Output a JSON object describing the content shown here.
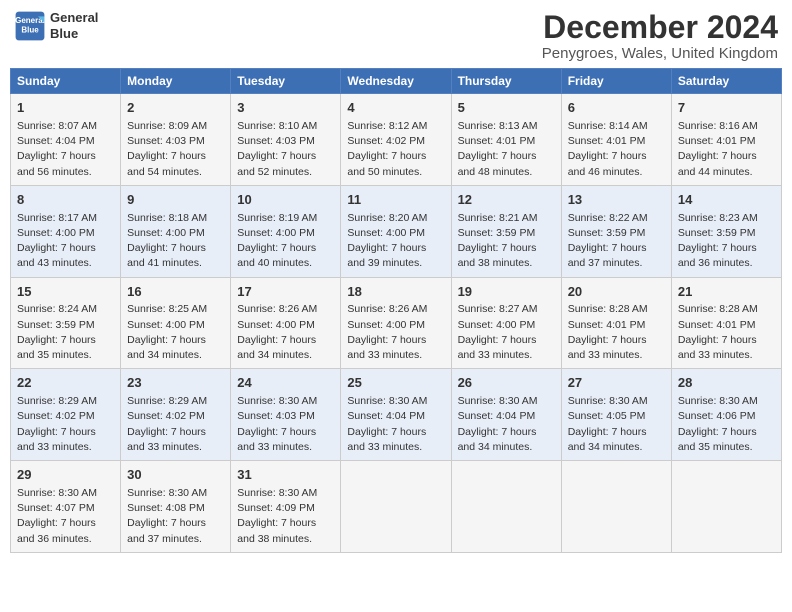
{
  "header": {
    "logo_line1": "General",
    "logo_line2": "Blue",
    "title": "December 2024",
    "subtitle": "Penygroes, Wales, United Kingdom"
  },
  "days_of_week": [
    "Sunday",
    "Monday",
    "Tuesday",
    "Wednesday",
    "Thursday",
    "Friday",
    "Saturday"
  ],
  "weeks": [
    [
      {
        "day": "1",
        "info": "Sunrise: 8:07 AM\nSunset: 4:04 PM\nDaylight: 7 hours\nand 56 minutes."
      },
      {
        "day": "2",
        "info": "Sunrise: 8:09 AM\nSunset: 4:03 PM\nDaylight: 7 hours\nand 54 minutes."
      },
      {
        "day": "3",
        "info": "Sunrise: 8:10 AM\nSunset: 4:03 PM\nDaylight: 7 hours\nand 52 minutes."
      },
      {
        "day": "4",
        "info": "Sunrise: 8:12 AM\nSunset: 4:02 PM\nDaylight: 7 hours\nand 50 minutes."
      },
      {
        "day": "5",
        "info": "Sunrise: 8:13 AM\nSunset: 4:01 PM\nDaylight: 7 hours\nand 48 minutes."
      },
      {
        "day": "6",
        "info": "Sunrise: 8:14 AM\nSunset: 4:01 PM\nDaylight: 7 hours\nand 46 minutes."
      },
      {
        "day": "7",
        "info": "Sunrise: 8:16 AM\nSunset: 4:01 PM\nDaylight: 7 hours\nand 44 minutes."
      }
    ],
    [
      {
        "day": "8",
        "info": "Sunrise: 8:17 AM\nSunset: 4:00 PM\nDaylight: 7 hours\nand 43 minutes."
      },
      {
        "day": "9",
        "info": "Sunrise: 8:18 AM\nSunset: 4:00 PM\nDaylight: 7 hours\nand 41 minutes."
      },
      {
        "day": "10",
        "info": "Sunrise: 8:19 AM\nSunset: 4:00 PM\nDaylight: 7 hours\nand 40 minutes."
      },
      {
        "day": "11",
        "info": "Sunrise: 8:20 AM\nSunset: 4:00 PM\nDaylight: 7 hours\nand 39 minutes."
      },
      {
        "day": "12",
        "info": "Sunrise: 8:21 AM\nSunset: 3:59 PM\nDaylight: 7 hours\nand 38 minutes."
      },
      {
        "day": "13",
        "info": "Sunrise: 8:22 AM\nSunset: 3:59 PM\nDaylight: 7 hours\nand 37 minutes."
      },
      {
        "day": "14",
        "info": "Sunrise: 8:23 AM\nSunset: 3:59 PM\nDaylight: 7 hours\nand 36 minutes."
      }
    ],
    [
      {
        "day": "15",
        "info": "Sunrise: 8:24 AM\nSunset: 3:59 PM\nDaylight: 7 hours\nand 35 minutes."
      },
      {
        "day": "16",
        "info": "Sunrise: 8:25 AM\nSunset: 4:00 PM\nDaylight: 7 hours\nand 34 minutes."
      },
      {
        "day": "17",
        "info": "Sunrise: 8:26 AM\nSunset: 4:00 PM\nDaylight: 7 hours\nand 34 minutes."
      },
      {
        "day": "18",
        "info": "Sunrise: 8:26 AM\nSunset: 4:00 PM\nDaylight: 7 hours\nand 33 minutes."
      },
      {
        "day": "19",
        "info": "Sunrise: 8:27 AM\nSunset: 4:00 PM\nDaylight: 7 hours\nand 33 minutes."
      },
      {
        "day": "20",
        "info": "Sunrise: 8:28 AM\nSunset: 4:01 PM\nDaylight: 7 hours\nand 33 minutes."
      },
      {
        "day": "21",
        "info": "Sunrise: 8:28 AM\nSunset: 4:01 PM\nDaylight: 7 hours\nand 33 minutes."
      }
    ],
    [
      {
        "day": "22",
        "info": "Sunrise: 8:29 AM\nSunset: 4:02 PM\nDaylight: 7 hours\nand 33 minutes."
      },
      {
        "day": "23",
        "info": "Sunrise: 8:29 AM\nSunset: 4:02 PM\nDaylight: 7 hours\nand 33 minutes."
      },
      {
        "day": "24",
        "info": "Sunrise: 8:30 AM\nSunset: 4:03 PM\nDaylight: 7 hours\nand 33 minutes."
      },
      {
        "day": "25",
        "info": "Sunrise: 8:30 AM\nSunset: 4:04 PM\nDaylight: 7 hours\nand 33 minutes."
      },
      {
        "day": "26",
        "info": "Sunrise: 8:30 AM\nSunset: 4:04 PM\nDaylight: 7 hours\nand 34 minutes."
      },
      {
        "day": "27",
        "info": "Sunrise: 8:30 AM\nSunset: 4:05 PM\nDaylight: 7 hours\nand 34 minutes."
      },
      {
        "day": "28",
        "info": "Sunrise: 8:30 AM\nSunset: 4:06 PM\nDaylight: 7 hours\nand 35 minutes."
      }
    ],
    [
      {
        "day": "29",
        "info": "Sunrise: 8:30 AM\nSunset: 4:07 PM\nDaylight: 7 hours\nand 36 minutes."
      },
      {
        "day": "30",
        "info": "Sunrise: 8:30 AM\nSunset: 4:08 PM\nDaylight: 7 hours\nand 37 minutes."
      },
      {
        "day": "31",
        "info": "Sunrise: 8:30 AM\nSunset: 4:09 PM\nDaylight: 7 hours\nand 38 minutes."
      },
      {
        "day": "",
        "info": ""
      },
      {
        "day": "",
        "info": ""
      },
      {
        "day": "",
        "info": ""
      },
      {
        "day": "",
        "info": ""
      }
    ]
  ]
}
